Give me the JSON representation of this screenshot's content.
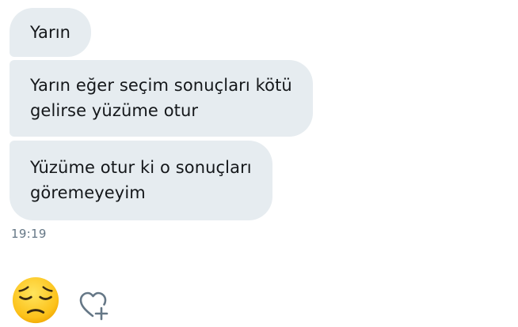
{
  "messages": [
    {
      "text": "Yarın"
    },
    {
      "lines": [
        "Yarın eğer seçim sonuçları kötü",
        "gelirse yüzüme otur"
      ]
    },
    {
      "lines": [
        "Yüzüme otur ki o sonuçları",
        "göremeyeyim"
      ]
    }
  ],
  "timestamp": "19:19",
  "reactions": {
    "emoji": "pensive-face",
    "add_reaction_icon": "heart-plus-icon"
  },
  "colors": {
    "bubble_background": "#e6ecf0",
    "text": "#14171a",
    "timestamp": "#657786",
    "icon_stroke": "#657786",
    "emoji_face": "#fcc21b"
  }
}
